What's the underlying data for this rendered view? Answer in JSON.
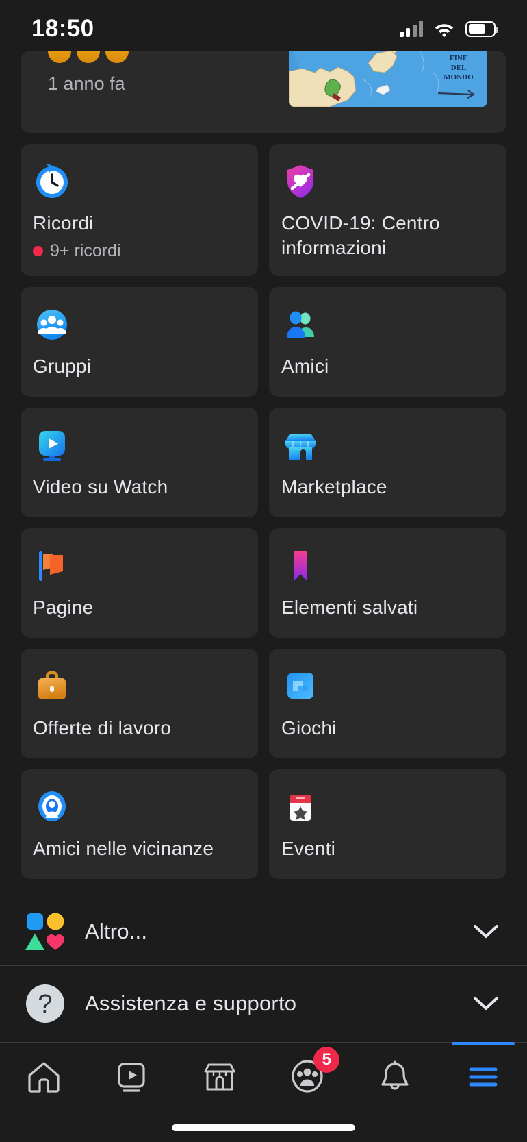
{
  "status_bar": {
    "time": "18:50",
    "cellular_icon": "cellular-signal-icon",
    "wifi_icon": "wifi-icon",
    "battery_icon": "battery-icon",
    "battery_level_percent": 70
  },
  "memory_card": {
    "time_ago": "1 anno fa",
    "thumbnail_alt": "map-meme-thumbnail",
    "thumbnail_text_line1": "FINE",
    "thumbnail_text_line2": "DEL",
    "thumbnail_text_line3": "MONDO",
    "reaction_avatar_count": 3
  },
  "shortcuts": [
    {
      "label": "Ricordi",
      "icon": "memories-clock-icon",
      "sub": "9+ ricordi",
      "has_badge_dot": true,
      "color_primary": "#1f8ff5",
      "color_secondary": "#ffffff"
    },
    {
      "label": "COVID-19: Centro informazioni",
      "icon": "covid-shield-heart-icon",
      "sub": "",
      "has_badge_dot": false,
      "color_primary": "#e040a0",
      "color_secondary": "#9b30e0"
    },
    {
      "label": "Gruppi",
      "icon": "groups-people-circle-icon",
      "sub": "",
      "has_badge_dot": false,
      "color_primary": "#0f9bf5",
      "color_secondary": "#53c4fb"
    },
    {
      "label": "Amici",
      "icon": "friends-two-people-icon",
      "sub": "",
      "has_badge_dot": false,
      "color_primary": "#1877f2",
      "color_secondary": "#3ddcb0"
    },
    {
      "label": "Video su Watch",
      "icon": "watch-play-icon",
      "sub": "",
      "has_badge_dot": false,
      "color_primary": "#36d6e7",
      "color_secondary": "#1b7ff0"
    },
    {
      "label": "Marketplace",
      "icon": "marketplace-storefront-icon",
      "sub": "",
      "has_badge_dot": false,
      "color_primary": "#48d2e8",
      "color_secondary": "#1784f3"
    },
    {
      "label": "Pagine",
      "icon": "pages-flag-icon",
      "sub": "",
      "has_badge_dot": false,
      "color_primary": "#f7752b",
      "color_secondary": "#2d88ff"
    },
    {
      "label": "Elementi salvati",
      "icon": "saved-bookmark-icon",
      "sub": "",
      "has_badge_dot": false,
      "color_primary": "#f53d8e",
      "color_secondary": "#8b30e8"
    },
    {
      "label": "Offerte di lavoro",
      "icon": "jobs-briefcase-icon",
      "sub": "",
      "has_badge_dot": false,
      "color_primary": "#f0a23c",
      "color_secondary": "#d4811a"
    },
    {
      "label": "Giochi",
      "icon": "gaming-square-icon",
      "sub": "",
      "has_badge_dot": false,
      "color_primary": "#1f9df7",
      "color_secondary": "#4fbcff"
    },
    {
      "label": "Amici nelle vicinanze",
      "icon": "nearby-friends-radar-icon",
      "sub": "",
      "has_badge_dot": false,
      "color_primary": "#1877f2",
      "color_secondary": "#4aa9ff"
    },
    {
      "label": "Eventi",
      "icon": "events-calendar-star-icon",
      "sub": "",
      "has_badge_dot": false,
      "color_primary": "#e4344a",
      "color_secondary": "#ffffff"
    }
  ],
  "expand_rows": [
    {
      "label": "Altro...",
      "icon": "more-shapes-icon",
      "chevron": "chevron-down-icon"
    },
    {
      "label": "Assistenza e supporto",
      "icon": "help-question-circle-icon",
      "chevron": "chevron-down-icon"
    }
  ],
  "more_icon_colors": {
    "square": "#1f9bf5",
    "circle": "#fbc02d",
    "triangle": "#3ddc97",
    "heart": "#f5366a"
  },
  "bottom_nav": {
    "active_index": 5,
    "active_color": "#2d88ff",
    "inactive_color": "#c8cacd",
    "badge_color": "#f02849",
    "tabs": [
      {
        "name": "home-tab",
        "icon": "home-icon",
        "badge": ""
      },
      {
        "name": "watch-tab",
        "icon": "watch-video-icon",
        "badge": ""
      },
      {
        "name": "marketplace-tab",
        "icon": "marketplace-icon",
        "badge": ""
      },
      {
        "name": "groups-tab",
        "icon": "groups-icon",
        "badge": "5"
      },
      {
        "name": "notifications-tab",
        "icon": "bell-icon",
        "badge": ""
      },
      {
        "name": "menu-tab",
        "icon": "hamburger-menu-icon",
        "badge": ""
      }
    ]
  }
}
